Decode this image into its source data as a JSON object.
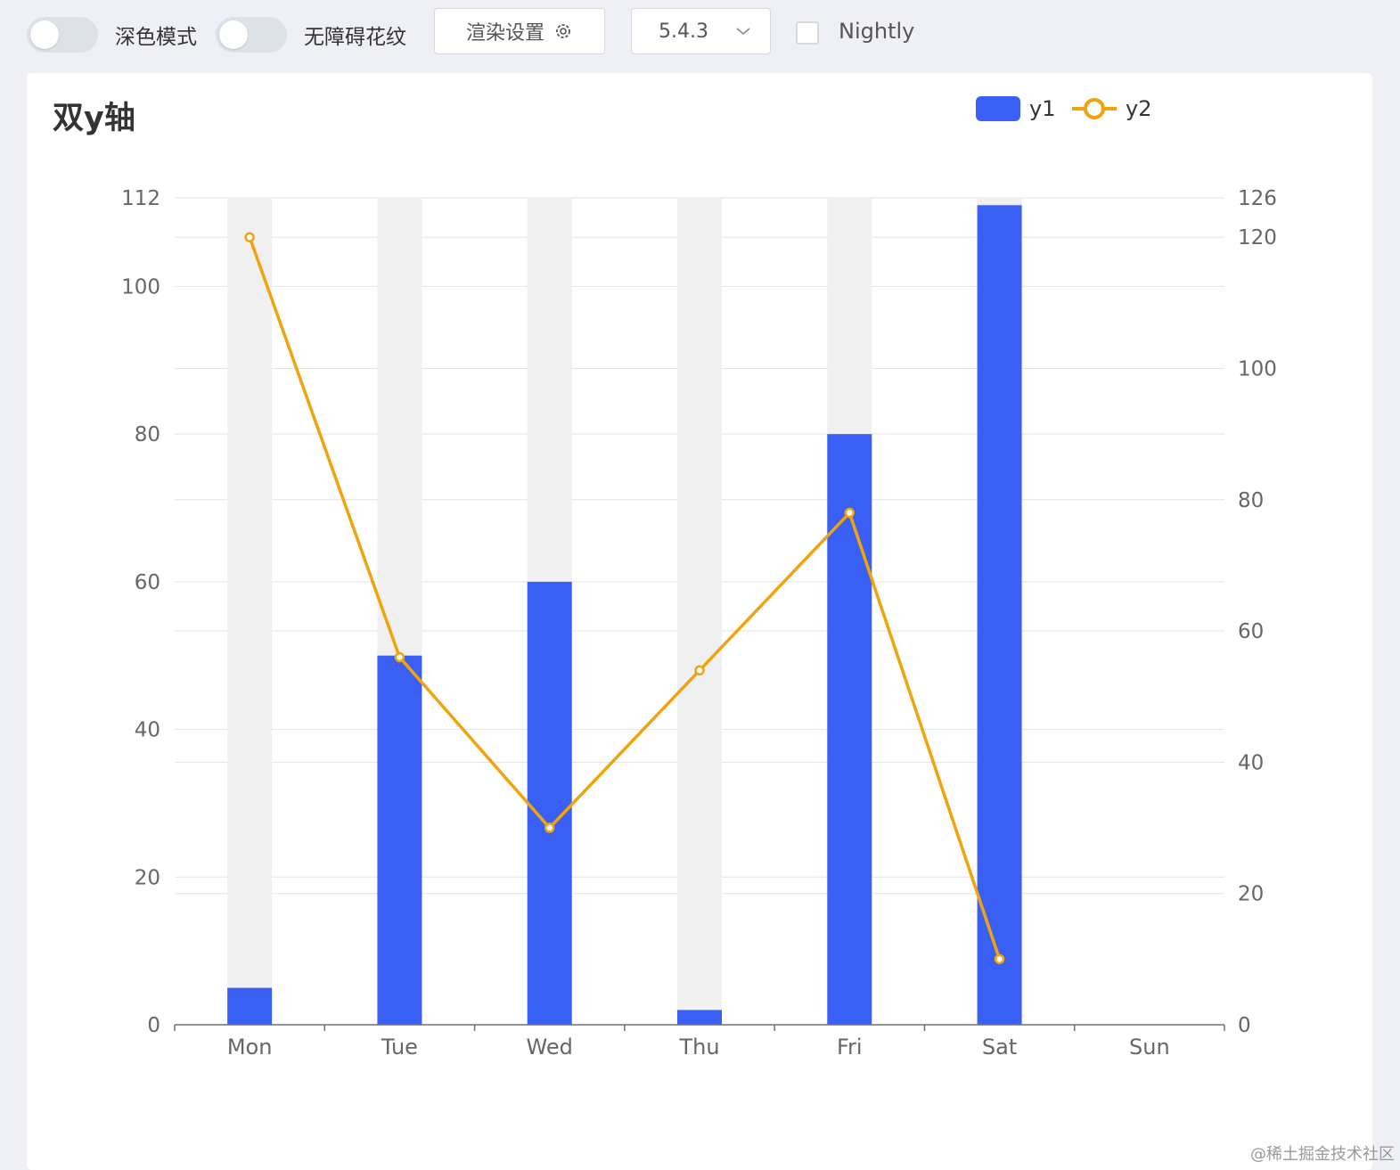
{
  "toolbar": {
    "dark_mode_label": "深色模式",
    "accessibility_label": "无障碍花纹",
    "render_settings_label": "渲染设置",
    "version_value": "5.4.3",
    "nightly_label": "Nightly",
    "dark_mode_on": false,
    "accessibility_on": false,
    "nightly_checked": false
  },
  "watermark": "@稀土掘金技术社区",
  "colors": {
    "bar": "#3a5ff5",
    "line": "#f0a30a",
    "bar_background": "#f0f0f0",
    "grid": "#e3e3e3"
  },
  "chart_data": {
    "type": "bar",
    "title": "双y轴",
    "categories": [
      "Mon",
      "Tue",
      "Wed",
      "Thu",
      "Fri",
      "Sat",
      "Sun"
    ],
    "series": [
      {
        "name": "y1",
        "type": "bar",
        "axis": "left",
        "values": [
          5,
          50,
          60,
          2,
          80,
          111,
          null
        ]
      },
      {
        "name": "y2",
        "type": "line",
        "axis": "right",
        "values": [
          120,
          56,
          30,
          54,
          78,
          10,
          null
        ]
      }
    ],
    "y_left": {
      "min": 0,
      "max": 112,
      "ticks": [
        "0",
        "20",
        "40",
        "60",
        "80",
        "100",
        "112"
      ]
    },
    "y_right": {
      "min": 0,
      "max": 126,
      "ticks": [
        "0",
        "20",
        "40",
        "60",
        "80",
        "100",
        "120",
        "126"
      ]
    },
    "legend_position": "top-right",
    "bar_background": true,
    "grid": true
  }
}
